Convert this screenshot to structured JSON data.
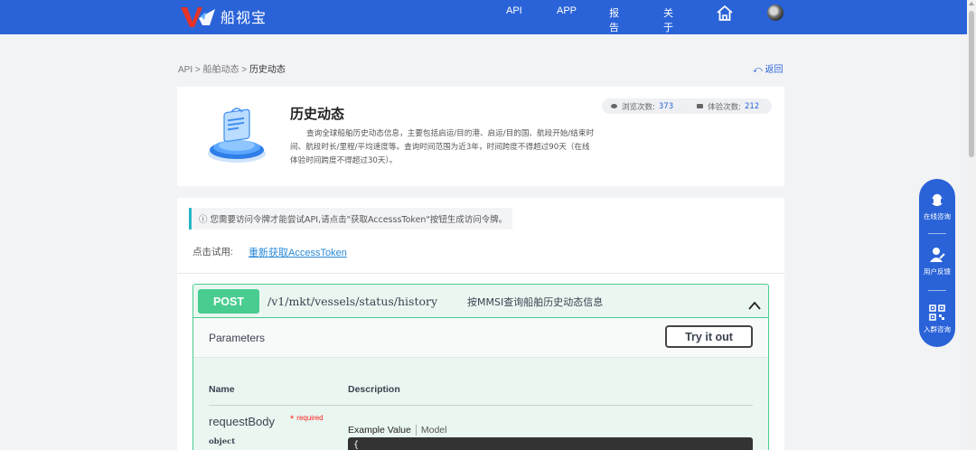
{
  "brand": {
    "name": "船视宝"
  },
  "nav": {
    "items": [
      "API",
      "APP",
      "报告",
      "关于"
    ]
  },
  "breadcrumb": {
    "root": "API",
    "sep": ">",
    "parent": "船舶动态",
    "current": "历史动态"
  },
  "back": {
    "label": "返回"
  },
  "api_info": {
    "title": "历史动态",
    "description": "查询全球船舶历史动态信息，主要包括启运/目的港、启运/目的国、航段开始/结束时间、航段时长/里程/平均速度等。查询时间范围为近3年，时间跨度不得超过90天（在线体验时间跨度不得超过30天）。",
    "views_label": "浏览次数:",
    "views": "373",
    "trials_label": "体验次数:",
    "trials": "212"
  },
  "notice": {
    "text": "ⓘ 您需要访问令牌才能尝试API,请点击\"获取AccesssToken\"按钮生成访问令牌。"
  },
  "try": {
    "label": "点击试用:",
    "link": "重新获取AccessToken"
  },
  "operation": {
    "method": "POST",
    "path": "/v1/mkt/vessels/status/history",
    "summary": "按MMSI查询船舶历史动态信息",
    "params_title": "Parameters",
    "try_button": "Try it out",
    "col_name": "Name",
    "col_description": "Description",
    "param_name": "requestBody",
    "param_required": "required",
    "param_type": "object",
    "example_tab": "Example Value",
    "model_tab": "Model",
    "code_start": "{"
  },
  "float_widget": {
    "items": [
      "在线咨询",
      "用户反馈",
      "入群咨询"
    ]
  },
  "colors": {
    "primary": "#2a63d8",
    "post": "#49cc90",
    "accent": "#29b6c6"
  },
  "icons": [
    "home-icon",
    "avatar",
    "eye-icon",
    "trial-icon",
    "chevron-up-icon",
    "headset-icon",
    "feedback-icon",
    "qrcode-icon",
    "back-arrow-icon"
  ]
}
